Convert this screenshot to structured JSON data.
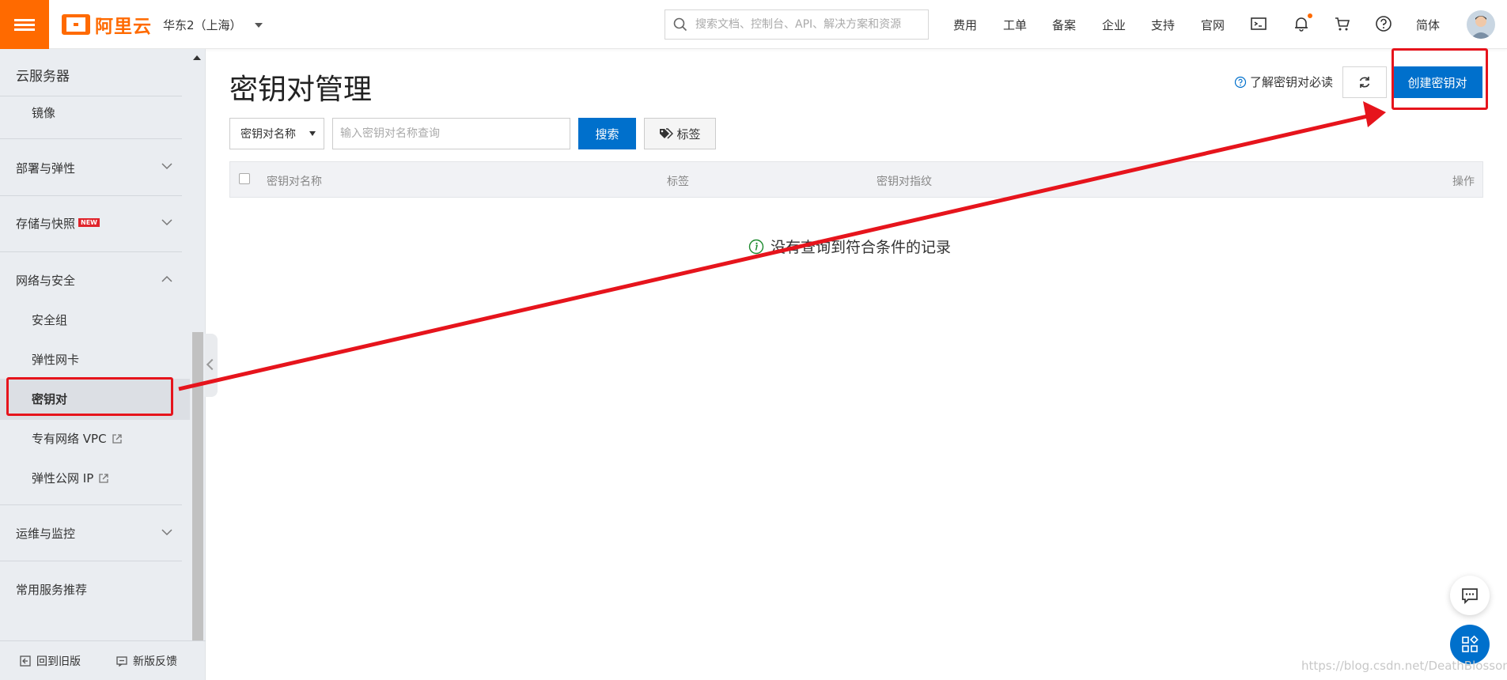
{
  "topbar": {
    "logo_text": "阿里云",
    "region": "华东2（上海）",
    "search_placeholder": "搜索文档、控制台、API、解决方案和资源",
    "nav": [
      "费用",
      "工单",
      "备案",
      "企业",
      "支持",
      "官网"
    ],
    "icons": [
      "terminal-icon",
      "bell-icon",
      "cart-icon",
      "help-icon"
    ],
    "language": "简体",
    "accent_color": "#ff6a00"
  },
  "sidebar": {
    "title": "云服务器",
    "items": {
      "image": "镜像",
      "deploy": "部署与弹性",
      "storage": "存储与快照",
      "storage_badge": "NEW",
      "network": "网络与安全",
      "security_group": "安全组",
      "eni": "弹性网卡",
      "keypair": "密钥对",
      "vpc": "专有网络 VPC",
      "eip": "弹性公网 IP",
      "ops": "运维与监控",
      "recommend": "常用服务推荐"
    },
    "footer": {
      "back_old": "回到旧版",
      "feedback": "新版反馈"
    }
  },
  "main": {
    "title": "密钥对管理",
    "help_link": "了解密钥对必读",
    "create_button": "创建密钥对",
    "filter": {
      "select_value": "密钥对名称",
      "input_placeholder": "输入密钥对名称查询",
      "search_button": "搜索",
      "tag_button": "标签"
    },
    "table": {
      "columns": [
        "密钥对名称",
        "标签",
        "密钥对指纹",
        "操作"
      ],
      "rows": [],
      "empty_message": "没有查询到符合条件的记录"
    },
    "primary_color": "#0070cc"
  },
  "watermark": "https://blog.csdn.net/DeathBlossom",
  "annotation_color": "#e6141c"
}
